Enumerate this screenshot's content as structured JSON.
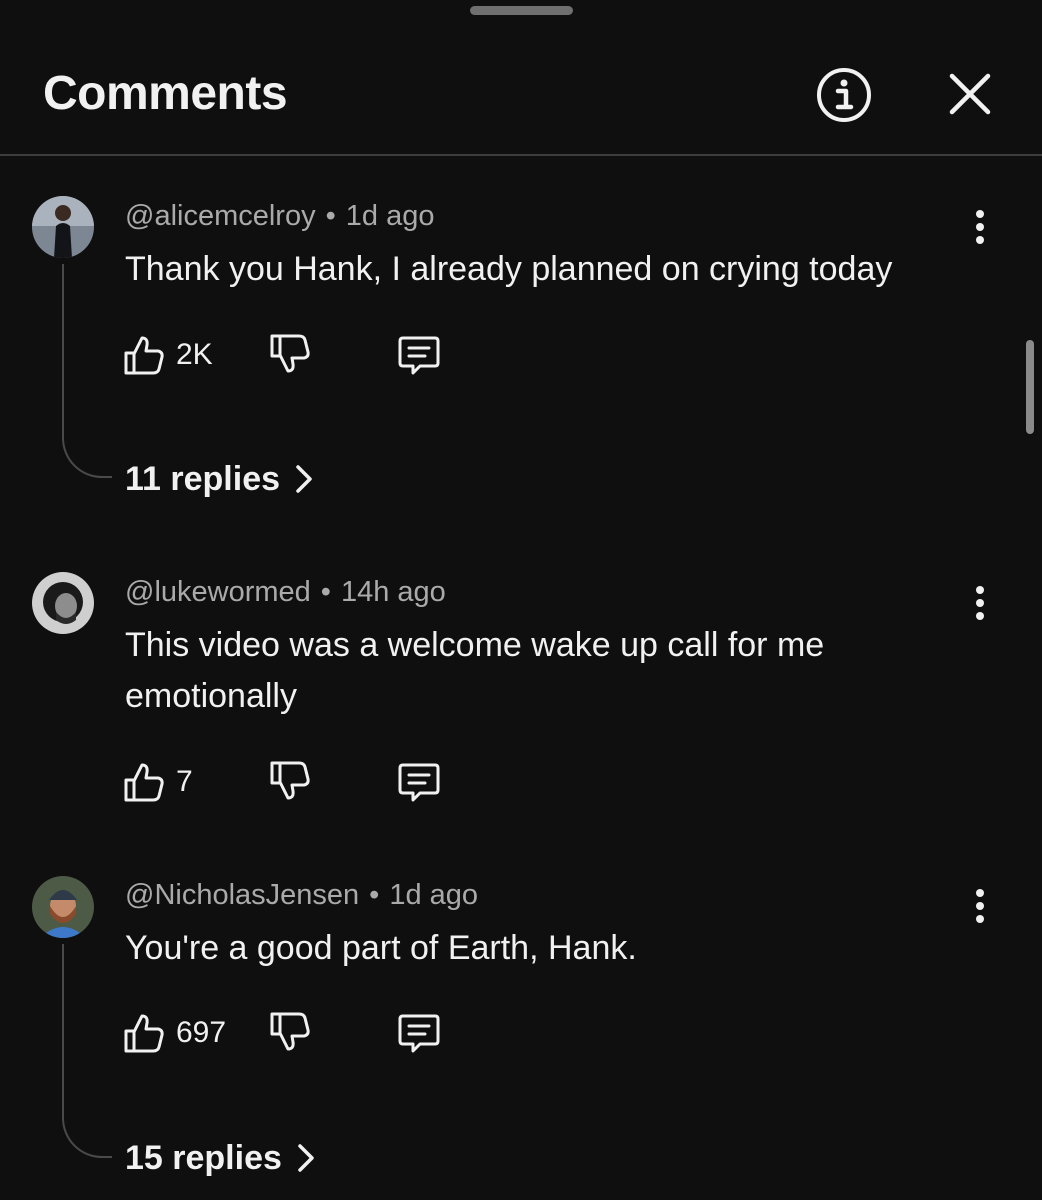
{
  "header": {
    "title": "Comments",
    "info_icon": "info-circle-icon",
    "close_icon": "close-icon"
  },
  "comments": [
    {
      "handle": "@alicemcelroy",
      "time": "1d ago",
      "text": "Thank you Hank, I already planned on crying today",
      "likes": "2K",
      "replies_label": "11 replies"
    },
    {
      "handle": "@lukewormed",
      "time": "14h ago",
      "text": "This video was a welcome wake up call for me emotionally",
      "likes": "7"
    },
    {
      "handle": "@NicholasJensen",
      "time": "1d ago",
      "text": "You're a good part of Earth, Hank.",
      "likes": "697",
      "replies_label": "15 replies"
    }
  ],
  "separator": "•",
  "colors": {
    "background": "#0f0f0f",
    "text_primary": "#f1f1f1",
    "text_secondary": "#aaaaaa",
    "divider": "#3d3d3d"
  }
}
